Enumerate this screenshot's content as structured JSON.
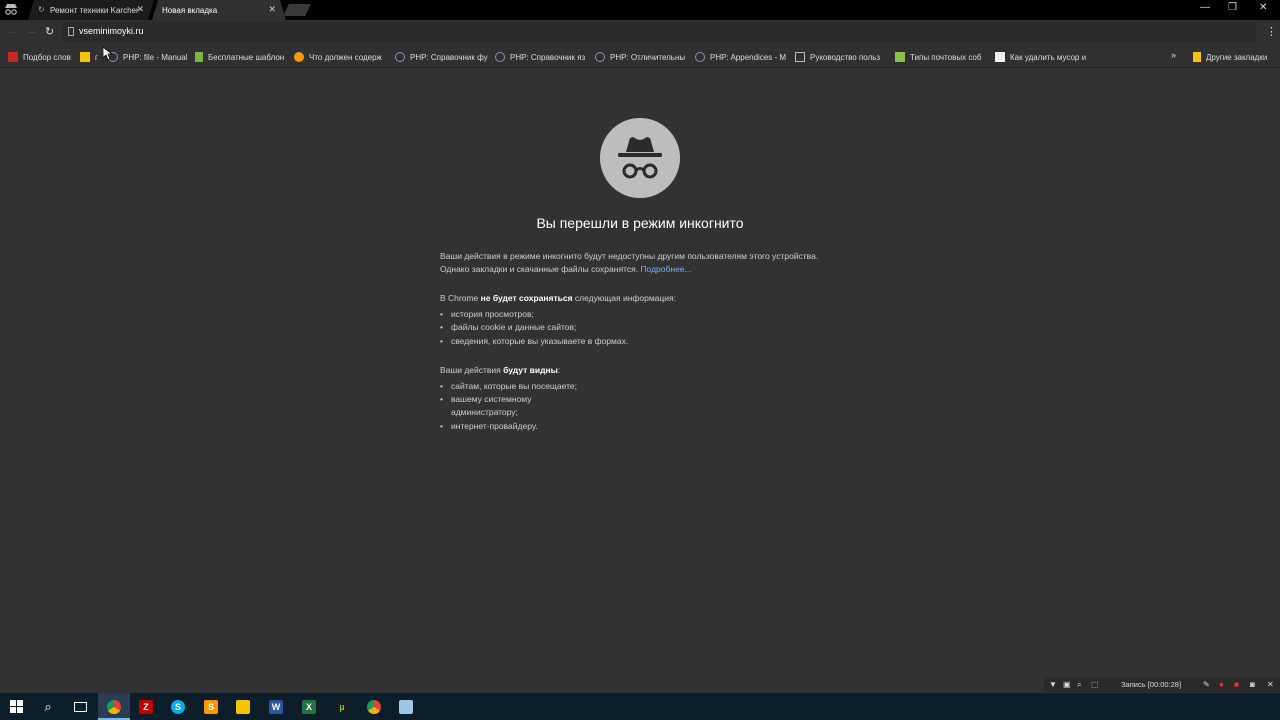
{
  "browser": {
    "tabs": [
      {
        "title": "Ремонт техники Karcher",
        "active": false
      },
      {
        "title": "Новая вкладка",
        "active": true
      }
    ],
    "address": "vseminimoyki.ru"
  },
  "bookmarks": [
    {
      "label": "Подбор слов",
      "icon": "bookmark-favicon-red"
    },
    {
      "label": "г",
      "icon": "bookmark-favicon-yellow"
    },
    {
      "label": "PHP: file - Manual",
      "icon": "php-icon"
    },
    {
      "label": "Бесплатные шаблон",
      "icon": "bookmark-favicon-green"
    },
    {
      "label": "Что должен содерж",
      "icon": "bookmark-favicon-orange"
    },
    {
      "label": "PHP: Справочник фу",
      "icon": "php-icon"
    },
    {
      "label": "PHP: Справочник яз",
      "icon": "php-icon"
    },
    {
      "label": "PHP: Отличительны",
      "icon": "php-icon"
    },
    {
      "label": "PHP: Appendices - M",
      "icon": "php-icon"
    },
    {
      "label": "Руководство польз",
      "icon": "page-icon"
    },
    {
      "label": "Типы почтовых соб",
      "icon": "bookmark-favicon-green"
    },
    {
      "label": "Как удалить мусор и",
      "icon": "bookmark-favicon-t"
    }
  ],
  "bookmarks_more": "»",
  "other_bookmarks": "Другие закладки",
  "incognito": {
    "heading": "Вы перешли в режим инкогнито",
    "p1": "Ваши действия в режиме инкогнито будут недоступны другим пользователям этого устройства. Однако закладки и скачанные файлы сохранятся.",
    "p1_link": "Подробнее...",
    "p2_prefix": "В Chrome ",
    "p2_bold": "не будет сохраняться",
    "p2_suffix": " следующая информация:",
    "list1": [
      "история просмотров;",
      "файлы cookie и данные сайтов;",
      "сведения, которые вы указываете в формах."
    ],
    "p3_prefix": "Ваши действия ",
    "p3_bold": "будут видны",
    "p3_suffix": ":",
    "list2": [
      "сайтам, которые вы посещаете;",
      "вашему системному администратору;",
      "интернет-провайдеру."
    ]
  },
  "recorder": {
    "label": "Запись [00:00:28]"
  },
  "colors": {
    "link": "#7cacf8",
    "background": "#323232",
    "taskbar": "#0d1e2b"
  }
}
